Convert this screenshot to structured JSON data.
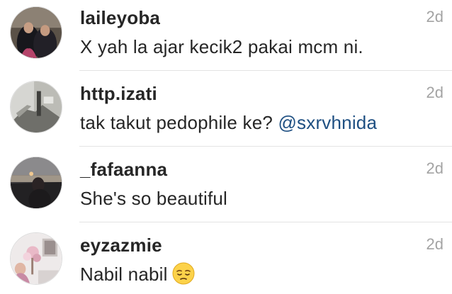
{
  "comments": [
    {
      "username": "laileyoba",
      "text": "X yah la ajar kecik2 pakai mcm ni.",
      "time": "2d"
    },
    {
      "username": "http.izati",
      "text": "tak takut pedophile ke? ",
      "mention": "@sxrvhnida",
      "time": "2d"
    },
    {
      "username": "_fafaanna",
      "text": "She's so beautiful",
      "time": "2d"
    },
    {
      "username": "eyzazmie",
      "text": "Nabil nabil",
      "emoji": "pensive-face",
      "time": "2d"
    }
  ],
  "colors": {
    "username": "#262626",
    "text": "#262626",
    "mention": "#1e4f82",
    "time": "#a3a3a3",
    "divider": "#e3e3e3"
  }
}
